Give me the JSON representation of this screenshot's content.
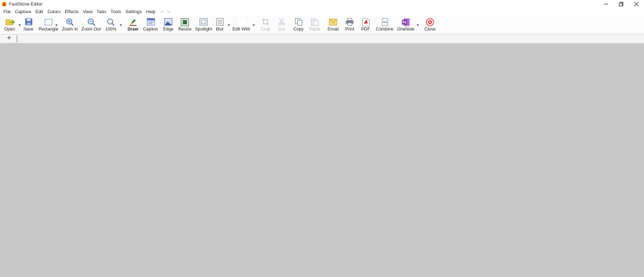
{
  "window": {
    "title": "FastStone Editor",
    "controls": [
      "minimize",
      "restore",
      "close"
    ]
  },
  "menu": {
    "items": [
      "File",
      "Capture",
      "Edit",
      "Colors",
      "Effects",
      "View",
      "Tabs",
      "Tools",
      "Settings",
      "Help"
    ]
  },
  "toolbar": {
    "open": "Open",
    "save": "Save",
    "rectangle": "Rectangle",
    "zoom_in": "Zoom In",
    "zoom_out": "Zoom Out",
    "zoom_level": "100%",
    "draw": "Draw",
    "caption": "Caption",
    "edge": "Edge",
    "resize": "Resize",
    "spotlight": "Spotlight",
    "blur": "Blur",
    "edit_with": "Edit With",
    "crop": "Crop",
    "cut": "Cut",
    "copy": "Copy",
    "paste": "Paste",
    "email": "Email",
    "print": "Print",
    "pdf": "PDF",
    "combine": "Combine",
    "onenote": "OneNote",
    "close": "Close"
  },
  "tabs": {
    "add_label": "+"
  },
  "colors": {
    "canvas": "#c8c8c8",
    "onenote": "#7b2fa8",
    "pdf": "#d32f2f",
    "close": "#e53935"
  }
}
